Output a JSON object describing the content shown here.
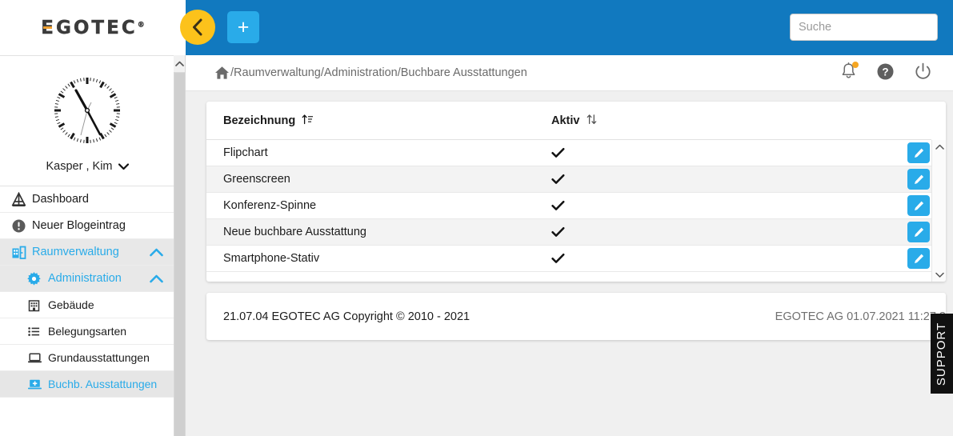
{
  "brand": {
    "logo_text": "EGOTEC",
    "logo_registered": "®"
  },
  "colors": {
    "header_blue": "#1179bf",
    "accent_blue": "#29abe9",
    "collapse_yellow": "#fcc21b",
    "notification_orange": "#f5a623",
    "logo_orange": "#f0a030",
    "support_black": "#111111"
  },
  "topbar": {
    "collapse_button_label": "",
    "collapse_icon": "chevron-left-icon",
    "add_button_label": "+",
    "add_icon": "plus-icon"
  },
  "search": {
    "placeholder": "Suche",
    "value": ""
  },
  "breadcrumb": {
    "home_icon": "home-icon",
    "path": "/Raumverwaltung/Administration/Buchbare Ausstattungen"
  },
  "header_icons": [
    {
      "name": "notifications-icon",
      "label": "Benachrichtigungen",
      "has_dot": true
    },
    {
      "name": "help-icon",
      "label": "Hilfe",
      "has_dot": false
    },
    {
      "name": "power-icon",
      "label": "Abmelden",
      "has_dot": false
    }
  ],
  "profile": {
    "avatar_icon": "analog-clock-avatar",
    "name": "Kasper , Kim",
    "chevron": "chevron-down-icon"
  },
  "sidebar": {
    "items": [
      {
        "label": "Dashboard",
        "icon": "dashboard-icon",
        "level": 0,
        "active": false,
        "chevron": ""
      },
      {
        "label": "Neuer Blogeintrag",
        "icon": "info-icon",
        "level": 0,
        "active": false,
        "chevron": ""
      },
      {
        "label": "Raumverwaltung",
        "icon": "room-door-icon",
        "level": 0,
        "active": true,
        "chevron": "chevron-up-icon"
      },
      {
        "label": "Administration",
        "icon": "gear-icon",
        "level": 1,
        "active": true,
        "chevron": "chevron-up-icon"
      },
      {
        "label": "Gebäude",
        "icon": "building-icon",
        "level": 2,
        "active": false,
        "chevron": ""
      },
      {
        "label": "Belegungsarten",
        "icon": "list-icon",
        "level": 2,
        "active": false,
        "chevron": ""
      },
      {
        "label": "Grundausstattungen",
        "icon": "laptop-icon",
        "level": 2,
        "active": false,
        "chevron": ""
      },
      {
        "label": "Buchb. Ausstattungen",
        "icon": "laptop-plus-icon",
        "level": 2,
        "active": false,
        "chevron": "",
        "current": true
      }
    ]
  },
  "table": {
    "columns": [
      {
        "label": "Bezeichnung",
        "sort_icon": "sort-ascending-icon"
      },
      {
        "label": "Aktiv",
        "sort_icon": "sort-both-icon"
      }
    ],
    "rows": [
      {
        "bezeichnung": "Flipchart",
        "aktiv": true,
        "edit_icon": "pencil-icon"
      },
      {
        "bezeichnung": "Greenscreen",
        "aktiv": true,
        "edit_icon": "pencil-icon"
      },
      {
        "bezeichnung": "Konferenz-Spinne",
        "aktiv": true,
        "edit_icon": "pencil-icon"
      },
      {
        "bezeichnung": "Neue buchbare Ausstattung",
        "aktiv": true,
        "edit_icon": "pencil-icon"
      },
      {
        "bezeichnung": "Smartphone-Stativ",
        "aktiv": true,
        "edit_icon": "pencil-icon"
      }
    ],
    "scroll_up_icon": "chevron-up-icon",
    "scroll_down_icon": "chevron-down-icon"
  },
  "footer": {
    "left": "21.07.04 EGOTEC AG Copyright © 2010 - 2021",
    "right": "EGOTEC AG  01.07.2021 11:27:3"
  },
  "support": {
    "label": "SUPPORT"
  }
}
